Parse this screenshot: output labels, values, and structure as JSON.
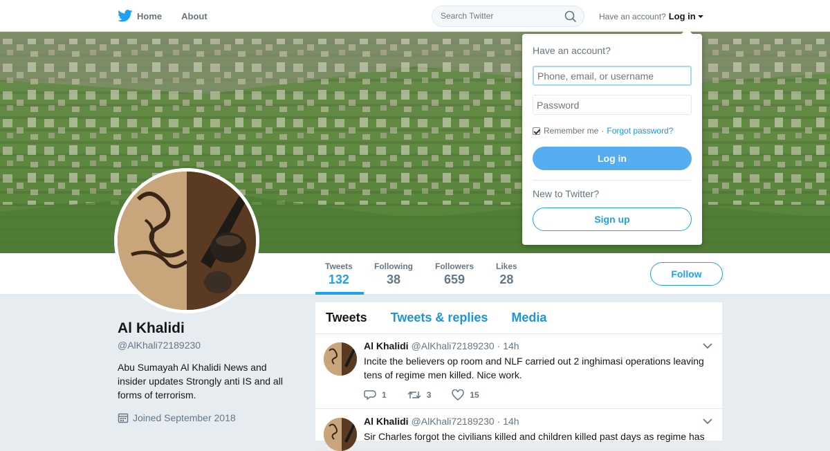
{
  "nav": {
    "home": "Home",
    "about": "About"
  },
  "search": {
    "placeholder": "Search Twitter"
  },
  "login_toggle": {
    "prompt": "Have an account?",
    "action": "Log in"
  },
  "login_dropdown": {
    "title": "Have an account?",
    "username_placeholder": "Phone, email, or username",
    "password_placeholder": "Password",
    "remember": "Remember me",
    "separator": "·",
    "forgot": "Forgot password?",
    "login_button": "Log in",
    "new_to": "New to Twitter?",
    "signup_button": "Sign up"
  },
  "stats": [
    {
      "label": "Tweets",
      "value": "132"
    },
    {
      "label": "Following",
      "value": "38"
    },
    {
      "label": "Followers",
      "value": "659"
    },
    {
      "label": "Likes",
      "value": "28"
    }
  ],
  "follow_button": "Follow",
  "profile": {
    "name": "Al Khalidi",
    "handle": "@AlKhali72189230",
    "bio": "Abu Sumayah Al Khalidi News and insider updates Strongly anti IS and all forms of terrorism.",
    "joined": "Joined September 2018"
  },
  "timeline_tabs": [
    "Tweets",
    "Tweets & replies",
    "Media"
  ],
  "tweets": [
    {
      "name": "Al Khalidi",
      "handle": "@AlKhali72189230",
      "time": "· 14h",
      "text": "Incite the believers op room and NLF carried out 2 inghimasi operations leaving tens of regime men killed. Nice work.",
      "replies": "1",
      "retweets": "3",
      "likes": "15"
    },
    {
      "name": "Al Khalidi",
      "handle": "@AlKhali72189230",
      "time": "· 14h",
      "text": "Sir Charles forgot the civilians killed and children killed past days as regime has"
    }
  ],
  "colors": {
    "accent": "#1da1f2",
    "button_blue": "#55acee",
    "background": "#e6ecf0"
  }
}
